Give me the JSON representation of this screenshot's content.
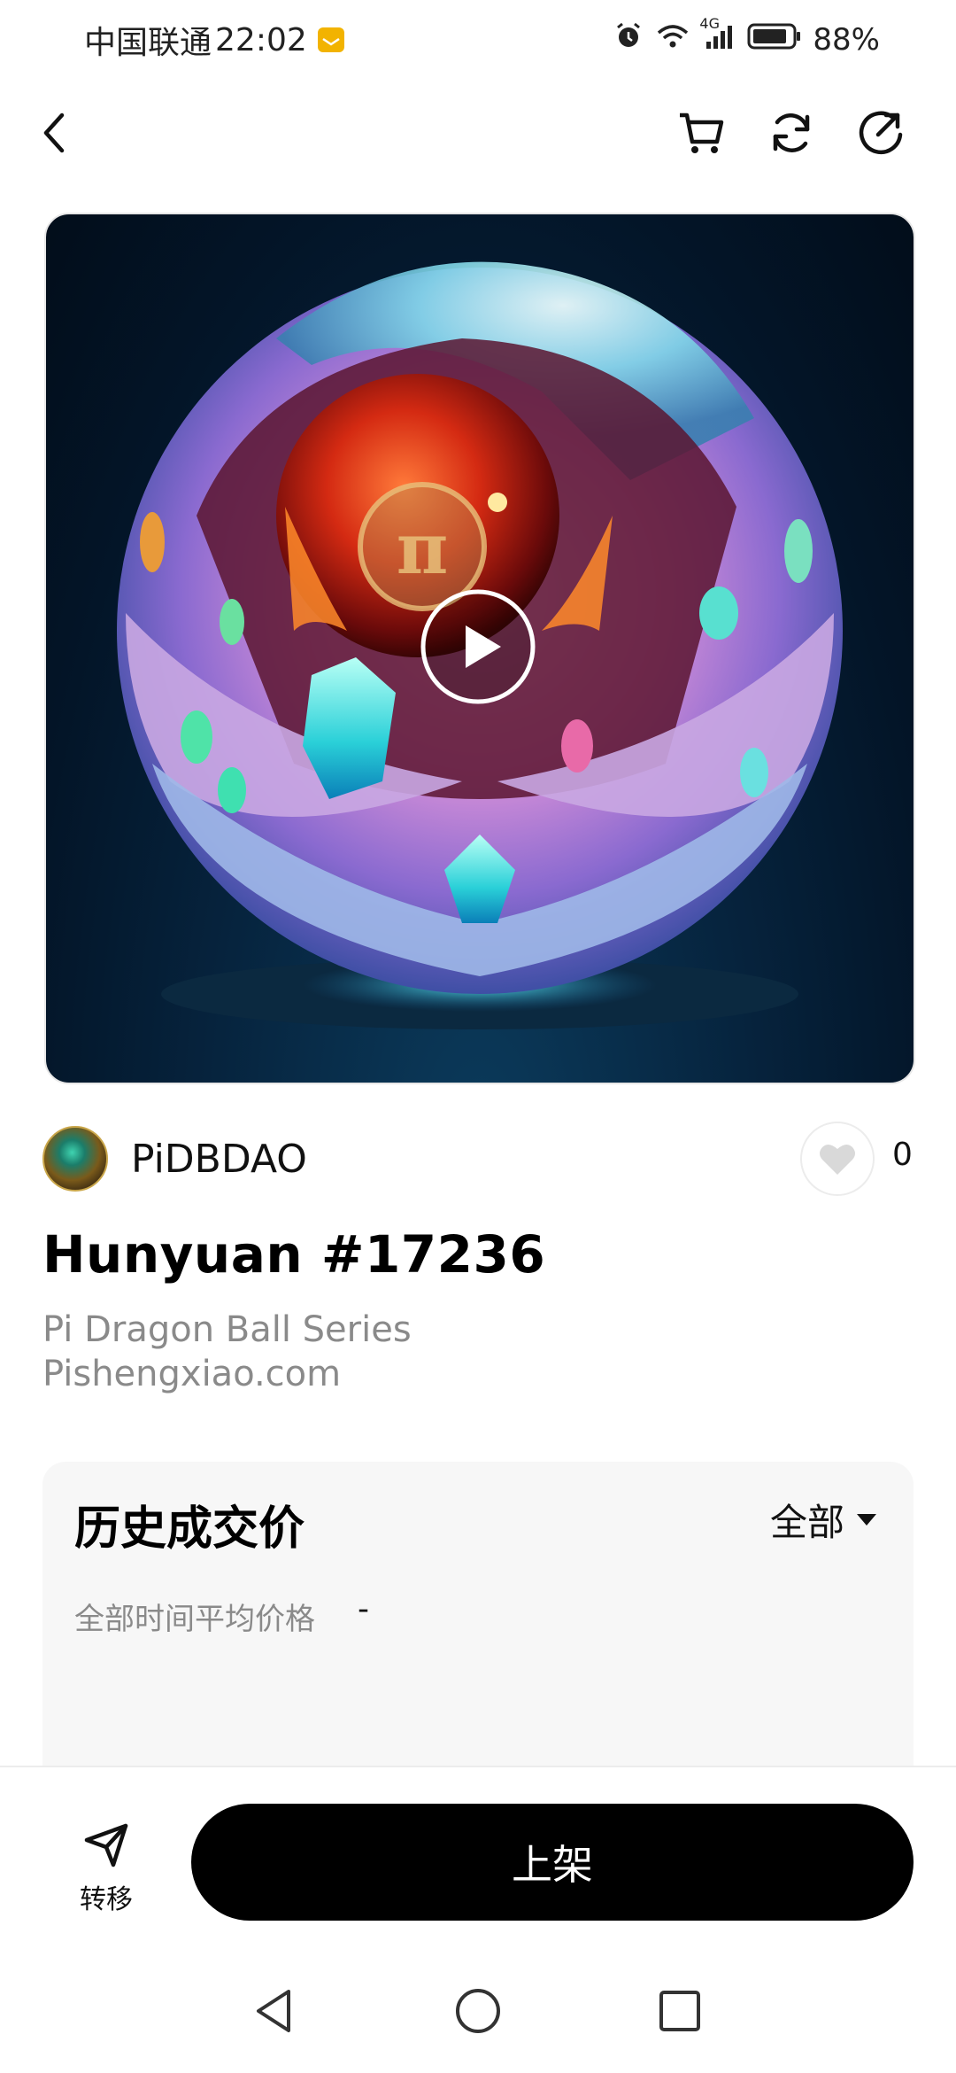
{
  "status_bar": {
    "carrier": "中国联通",
    "time": "22:02",
    "network": "4G",
    "battery": "88%",
    "battery_level": 0.88
  },
  "nav": {
    "icons": [
      "back-arrow-icon",
      "cart-icon",
      "refresh-icon",
      "share-icon"
    ]
  },
  "media": {
    "type": "video",
    "icon": "play-icon"
  },
  "creator": {
    "name": "PiDBDAO"
  },
  "likes": {
    "count": "0"
  },
  "item": {
    "title": "Hunyuan #17236",
    "subtitle_line1": "Pi Dragon Ball Series",
    "subtitle_line2": "Pishengxiao.com"
  },
  "history": {
    "title": "历史成交价",
    "filter": "全部",
    "avg_label": "全部时间平均价格",
    "avg_value": "-"
  },
  "actions": {
    "transfer_label": "转移",
    "list_label": "上架"
  },
  "colors": {
    "primary_button": "#000000",
    "secondary_text": "#8a8a8a",
    "card_bg": "#f7f7f7"
  }
}
